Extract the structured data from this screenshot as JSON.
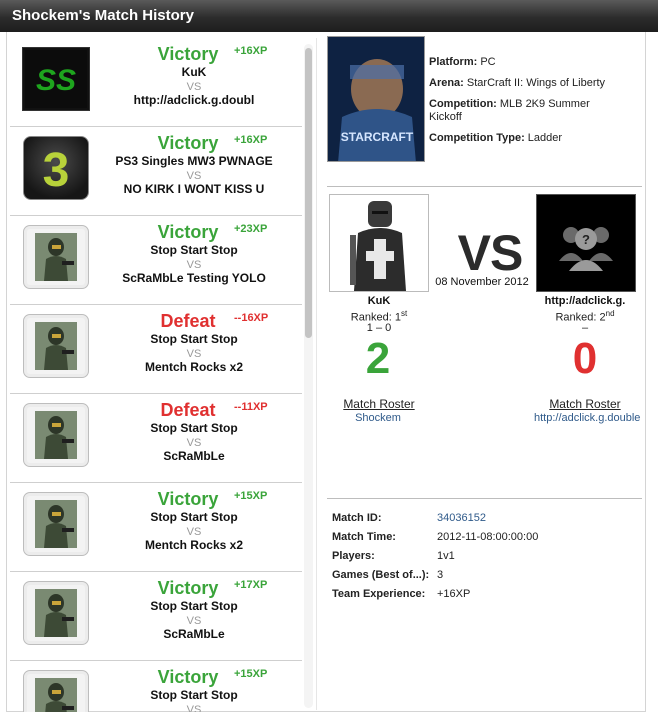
{
  "header": {
    "title": "Shockem's Match History"
  },
  "matches": [
    {
      "result": "Victory",
      "xp": "+16XP",
      "team1": "KuK",
      "team2": "http://adclick.g.doubl"
    },
    {
      "result": "Victory",
      "xp": "+16XP",
      "team1": "PS3 Singles MW3 PWNAGE",
      "team2": "NO KIRK I WONT KISS U"
    },
    {
      "result": "Victory",
      "xp": "+23XP",
      "team1": "Stop Start Stop",
      "team2": "ScRaMbLe Testing YOLO"
    },
    {
      "result": "Defeat",
      "xp": "--16XP",
      "team1": "Stop Start Stop",
      "team2": "Mentch Rocks x2"
    },
    {
      "result": "Defeat",
      "xp": "--11XP",
      "team1": "Stop Start Stop",
      "team2": "ScRaMbLe"
    },
    {
      "result": "Victory",
      "xp": "+15XP",
      "team1": "Stop Start Stop",
      "team2": "Mentch Rocks x2"
    },
    {
      "result": "Victory",
      "xp": "+17XP",
      "team1": "Stop Start Stop",
      "team2": "ScRaMbLe"
    },
    {
      "result": "Victory",
      "xp": "+15XP",
      "team1": "Stop Start Stop",
      "team2": ""
    }
  ],
  "vs_small": "VS",
  "game": {
    "platform_label": "Platform:",
    "platform": "PC",
    "arena_label": "Arena:",
    "arena": "StarCraft II: Wings of Liberty",
    "competition_label": "Competition:",
    "competition": "MLB 2K9 Summer Kickoff",
    "type_label": "Competition Type:",
    "type": "Ladder",
    "cover_text": "STARCRAFT"
  },
  "versus": {
    "vs": "VS",
    "date": "08 November 2012",
    "left": {
      "name": "KuK",
      "ranked": "Ranked: 1",
      "rank_sup": "st",
      "record": "1 – 0",
      "score": "2",
      "roster_title": "Match Roster",
      "roster_link": "Shockem"
    },
    "right": {
      "name": "http://adclick.g.",
      "ranked": "Ranked: 2",
      "rank_sup": "nd",
      "record": "–",
      "score": "0",
      "roster_title": "Match Roster",
      "roster_link": "http://adclick.g.double"
    }
  },
  "details": {
    "match_id_label": "Match ID:",
    "match_id": "34036152",
    "match_time_label": "Match Time:",
    "match_time": "2012-11-08:00:00:00",
    "players_label": "Players:",
    "players": "1v1",
    "games_label": "Games (Best of...):",
    "games": "3",
    "team_exp_label": "Team Experience:",
    "team_exp": "+16XP"
  },
  "colors": {
    "win": "#3aa43a",
    "loss": "#e03030",
    "link": "#2f5a8a"
  },
  "icons": {
    "match_thumbs": [
      "ss-logo-icon",
      "mw3-logo-icon",
      "halo-soldier-icon",
      "halo-soldier-icon",
      "halo-soldier-icon",
      "halo-soldier-icon",
      "halo-soldier-icon",
      "halo-soldier-icon"
    ],
    "left_avatar": "knight-avatar-icon",
    "right_avatar": "default-group-avatar-icon"
  }
}
